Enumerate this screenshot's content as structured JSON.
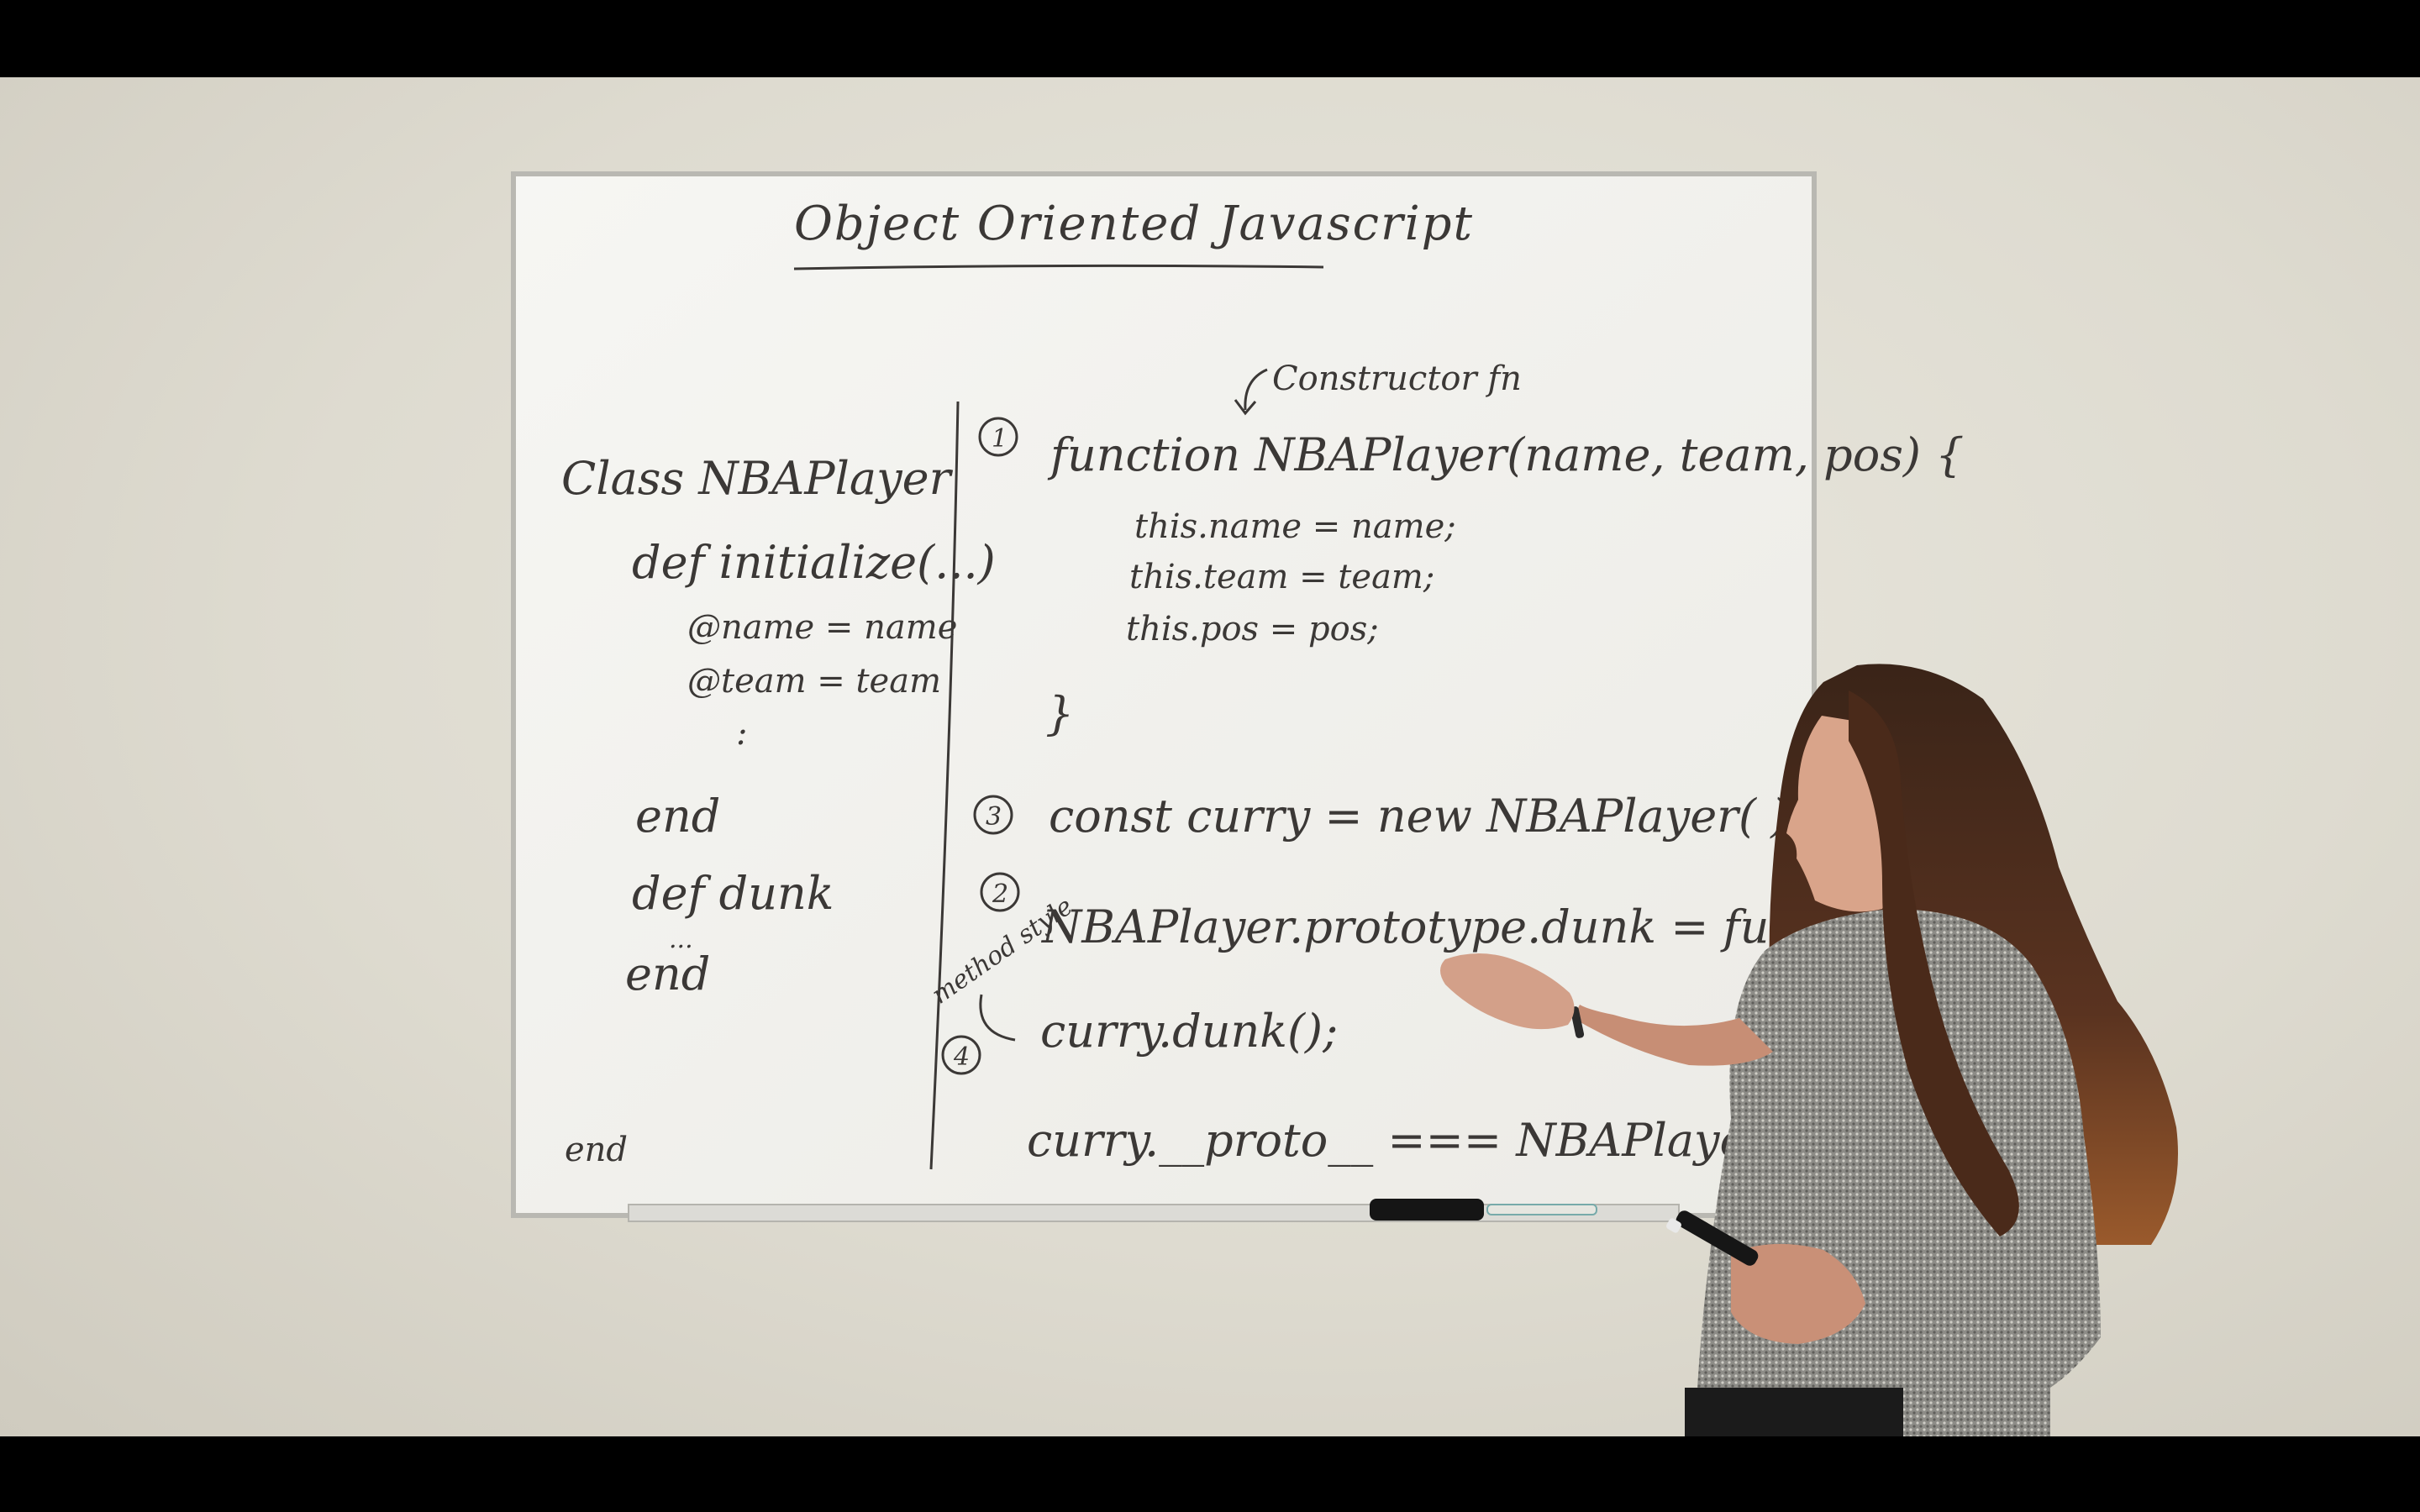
{
  "board": {
    "title": "Object Oriented Javascript",
    "ruby": {
      "class_line": "Class NBAPlayer",
      "def_init": "def initialize(...)",
      "ivar_name": "@name = name",
      "ivar_team": "@team = team",
      "ellipsis": ":",
      "end_init": "end",
      "def_dunk": "def dunk",
      "dunk_body": "...",
      "end_dunk": "end",
      "end_class": "end"
    },
    "js": {
      "annotation": "Constructor fn",
      "step1": "1",
      "func_line": "function NBAPlayer(name, team, pos) {",
      "assign_name": "this.name = name;",
      "assign_team": "this.team = team;",
      "assign_pos": "this.pos = pos;",
      "close_brace": "}",
      "step3": "3",
      "const_line": "const curry = new NBAPlayer(        )",
      "step2": "2",
      "proto_line": "NBAPlayer.prototype.dunk = function() {};",
      "method_style": "method style",
      "step4": "4",
      "call_line": "curry.dunk();",
      "proto_check": "curry.__proto__ === NBAPlayer.prototype"
    }
  },
  "colors": {
    "wall": "#dedbd0",
    "board": "#f4f4f1",
    "marker": "#3b3836",
    "letterbox": "#000000"
  }
}
